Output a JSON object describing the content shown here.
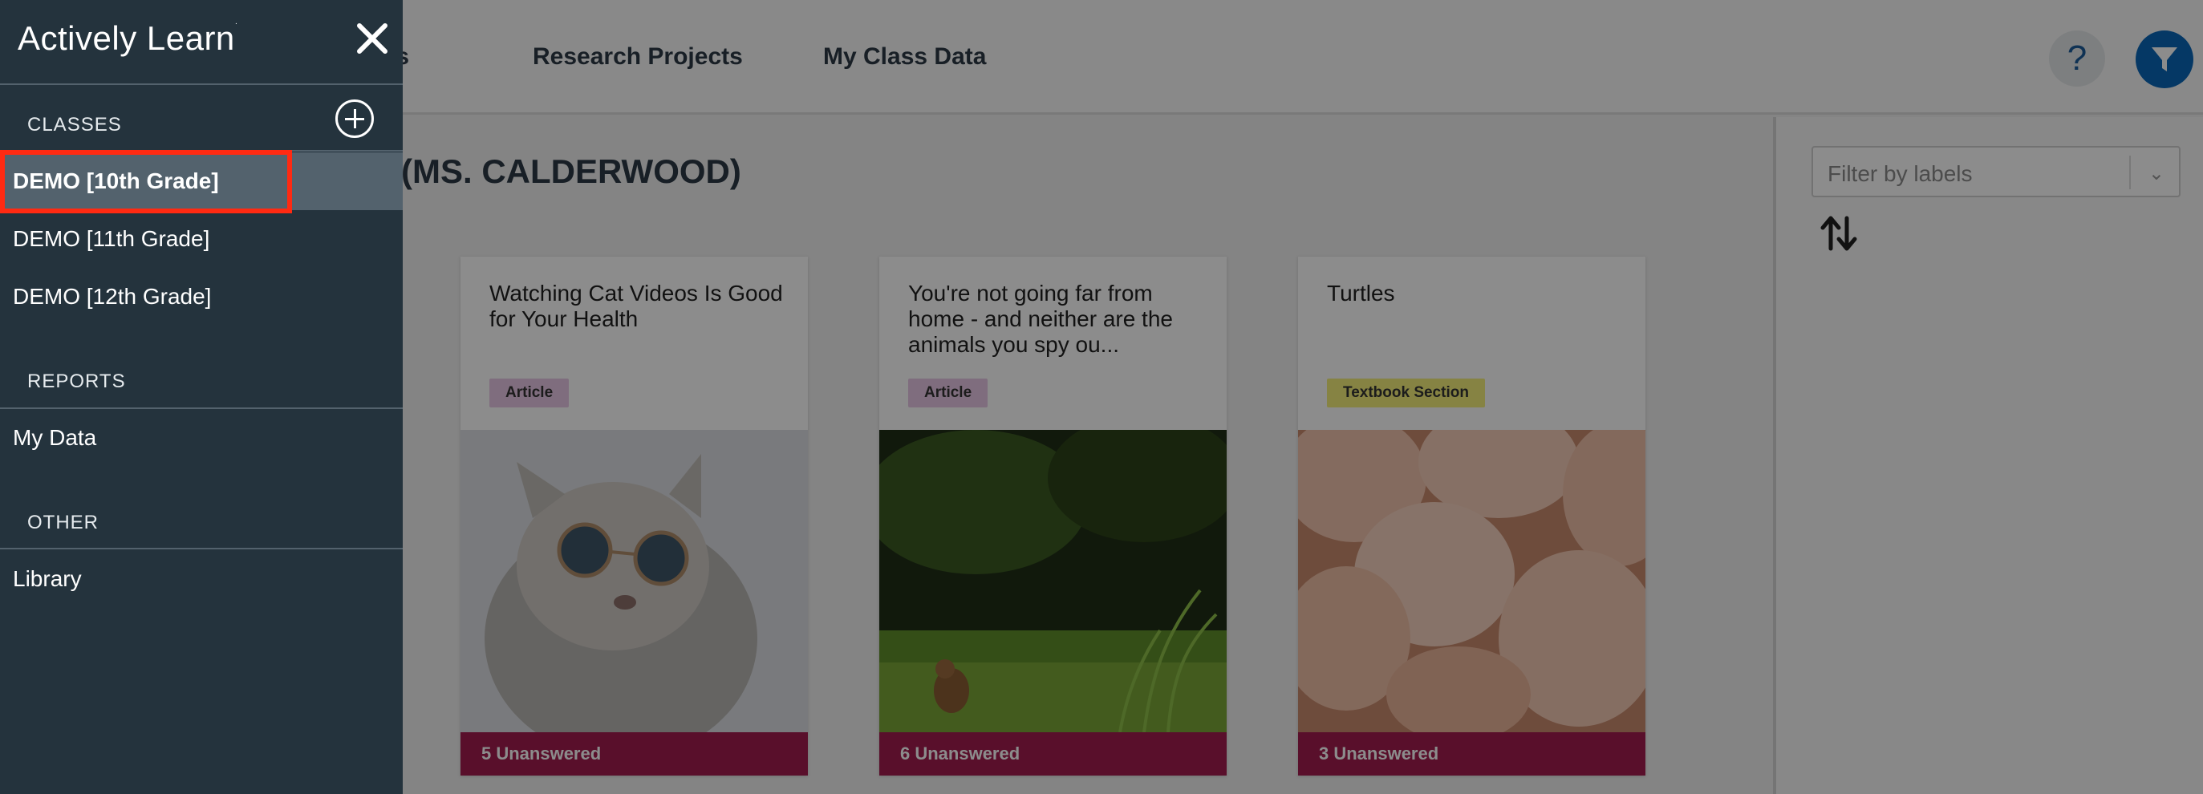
{
  "app": {
    "brand": "Actively Learn"
  },
  "top_nav": {
    "grades": "rades",
    "research": "Research Projects",
    "class_data": "My Class Data",
    "help": "?"
  },
  "main": {
    "class_title": "(MS. CALDERWOOD)"
  },
  "cards": [
    {
      "title": "Watching Cat Videos Is Good for Your Health",
      "badge": "Article",
      "footer": "5 Unanswered"
    },
    {
      "title": "You're not going far from home - and neither are the animals you spy ou...",
      "badge": "Article",
      "footer": "6 Unanswered"
    },
    {
      "title": "Turtles",
      "badge": "Textbook Section",
      "footer": "3 Unanswered"
    }
  ],
  "right_panel": {
    "filter_placeholder": "Filter by labels"
  },
  "sidebar": {
    "sections": {
      "classes": "CLASSES",
      "reports": "REPORTS",
      "other": "OTHER"
    },
    "classes": [
      {
        "label": "DEMO [10th Grade]",
        "active": true
      },
      {
        "label": "DEMO [11th Grade]",
        "active": false
      },
      {
        "label": "DEMO [12th Grade]",
        "active": false
      }
    ],
    "reports": [
      {
        "label": "My Data"
      }
    ],
    "other": [
      {
        "label": "Library"
      }
    ]
  },
  "colors": {
    "sidebar_bg": "#24333d",
    "active_item_bg": "#53626d",
    "highlight": "#ff2a12",
    "footer_bar": "#a31d4f",
    "filter_button": "#0a66b8"
  }
}
